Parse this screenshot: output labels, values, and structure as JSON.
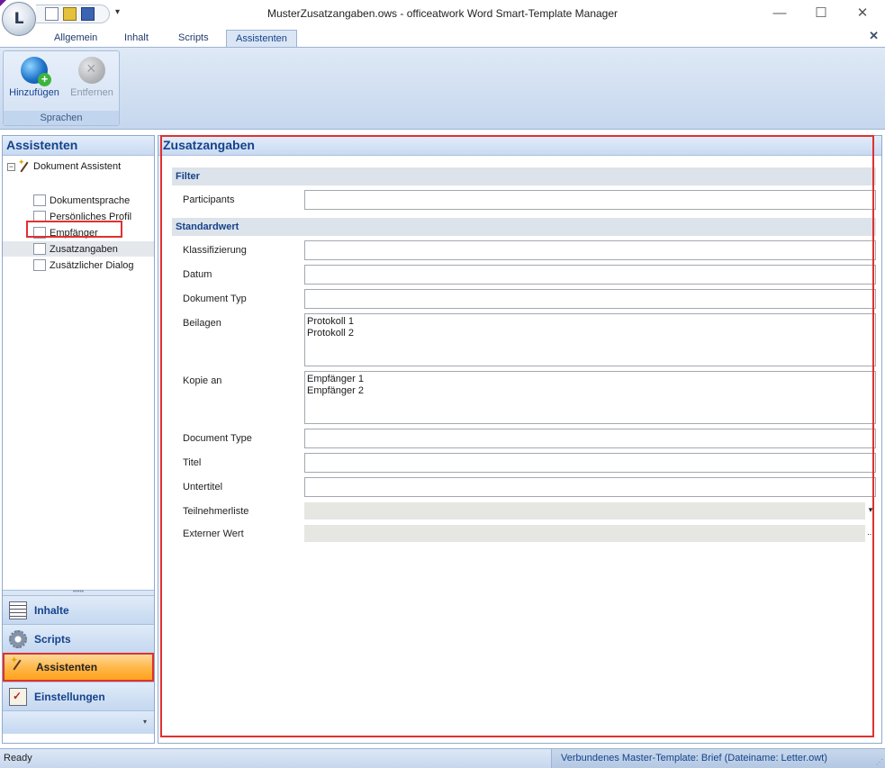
{
  "window": {
    "title": "MusterZusatzangaben.ows - officeatwork Word Smart-Template Manager",
    "orb_letter": "L",
    "qat_dropdown": "▾",
    "minimize": "—",
    "maximize": "☐",
    "close": "✕"
  },
  "ribbon": {
    "tabs": [
      "Allgemein",
      "Inhalt",
      "Scripts",
      "Assistenten"
    ],
    "active_tab": "Assistenten",
    "close_glyph": "✕",
    "group": {
      "label": "Sprachen",
      "buttons": [
        {
          "label": "Hinzufügen",
          "icon": "globe-add-icon",
          "enabled": true
        },
        {
          "label": "Entfernen",
          "icon": "globe-remove-icon",
          "enabled": false
        }
      ]
    }
  },
  "left_panel": {
    "title": "Assistenten",
    "tree": {
      "root": {
        "label": "Dokument Assistent",
        "expander": "−"
      },
      "items": [
        "Dokumentsprache",
        "Persönliches Profil",
        "Empfänger",
        "Zusatzangaben",
        "Zusätzlicher Dialog"
      ],
      "selected": "Zusatzangaben"
    },
    "splitter_glyph": "•••••",
    "nav": [
      {
        "label": "Inhalte",
        "icon": "document-list-icon"
      },
      {
        "label": "Scripts",
        "icon": "gear-icon"
      },
      {
        "label": "Assistenten",
        "icon": "wand-icon",
        "active": true
      },
      {
        "label": "Einstellungen",
        "icon": "clipboard-check-icon"
      }
    ],
    "footer_glyph": "▾"
  },
  "main_panel": {
    "title": "Zusatzangaben",
    "sections": {
      "filter": "Filter",
      "standardwert": "Standardwert"
    },
    "fields": {
      "participants": {
        "label": "Participants",
        "value": ""
      },
      "klassifizierung": {
        "label": "Klassifizierung",
        "value": ""
      },
      "datum": {
        "label": "Datum",
        "value": ""
      },
      "dokument_typ": {
        "label": "Dokument Typ",
        "value": ""
      },
      "beilagen": {
        "label": "Beilagen",
        "lines": [
          "Protokoll 1",
          "Protokoll 2"
        ]
      },
      "kopie_an": {
        "label": "Kopie an",
        "lines": [
          "Empfänger 1",
          "Empfänger 2"
        ]
      },
      "document_type": {
        "label": "Document Type",
        "value": ""
      },
      "titel": {
        "label": "Titel",
        "value": ""
      },
      "untertitel": {
        "label": "Untertitel",
        "value": ""
      },
      "teilnehmerliste": {
        "label": "Teilnehmerliste",
        "side": "▾"
      },
      "externer_wert": {
        "label": "Externer Wert",
        "side": "..."
      }
    }
  },
  "status": {
    "left": "Ready",
    "right": "Verbundenes Master-Template: Brief (Dateiname: Letter.owt)",
    "grip": "⋰"
  }
}
